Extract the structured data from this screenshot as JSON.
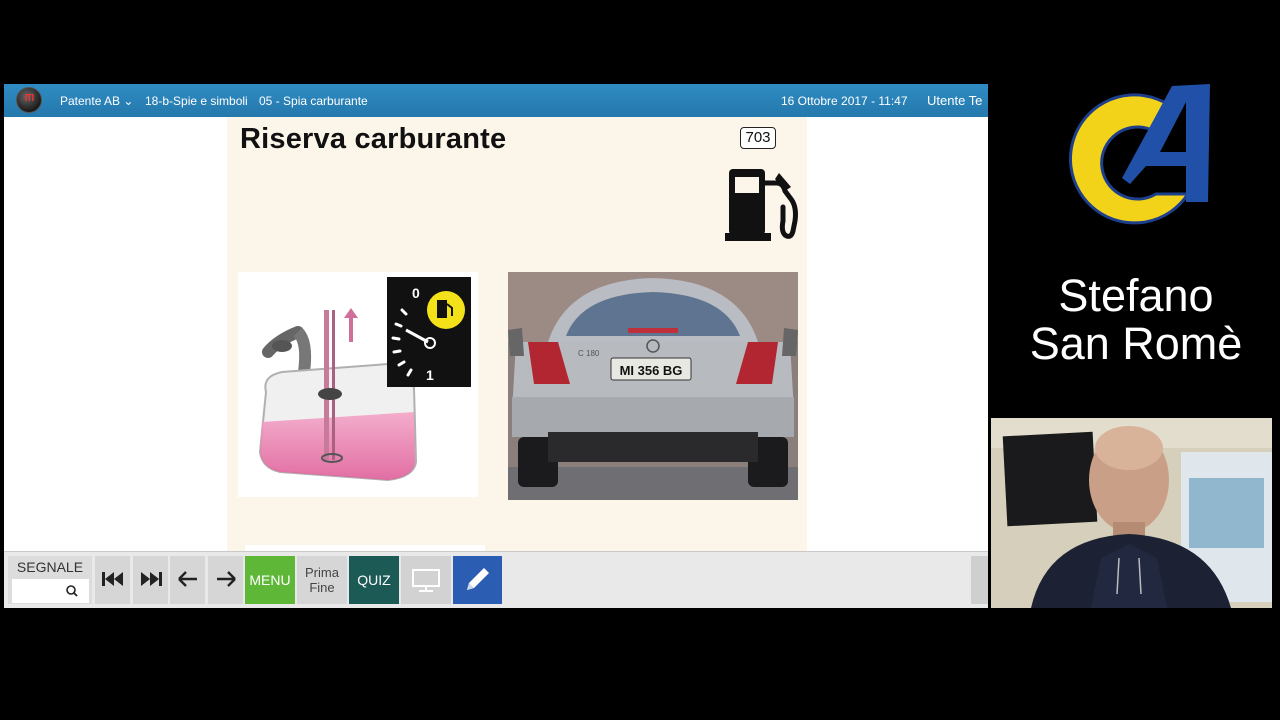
{
  "topbar": {
    "breadcrumb": [
      "Patente AB ⌄",
      "18-b-Spie e simboli",
      "05 - Spia carburante"
    ],
    "datetime": "16 Ottobre 2017 - 11:47",
    "user": "Utente Te",
    "logo_text": "ITI"
  },
  "slide": {
    "title": "Riserva carburante",
    "sign_number": "703",
    "gauge_scale_top": "0",
    "gauge_scale_bottom": "1",
    "license_plate": "MI 356 BG",
    "badge": "C 180"
  },
  "toolbar": {
    "segnale_label": "SEGNALE",
    "segnale_value": "",
    "menu_label": "MENU",
    "prima_label": "Prima",
    "fine_label": "Fine",
    "quiz_label": "QUIZ"
  },
  "presenter": {
    "name_line1": "Stefano",
    "name_line2": "San Romè"
  },
  "colors": {
    "topbar": "#2a84bb",
    "menu": "#5fb737",
    "quiz": "#1c5a56",
    "edit": "#2b5eb2",
    "logo_yellow": "#f3d319",
    "logo_blue": "#2050a8"
  },
  "icons": [
    "fuel-pump-icon",
    "skip-back-icon",
    "skip-forward-icon",
    "arrow-left-icon",
    "arrow-right-icon",
    "search-icon",
    "monitor-icon",
    "pencil-icon"
  ]
}
